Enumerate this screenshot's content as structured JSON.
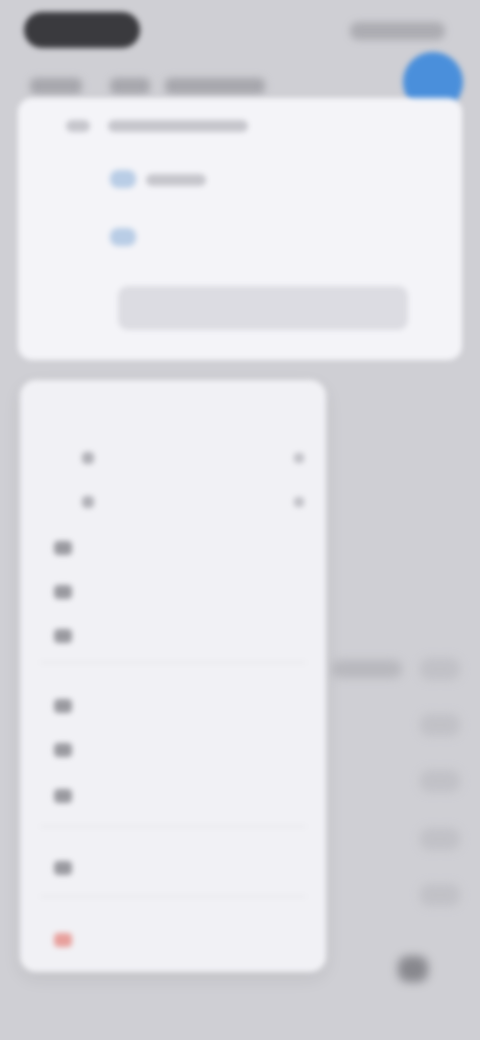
{
  "status_bar": {
    "time": "",
    "indicators": ""
  },
  "background_app": {
    "title": "",
    "fab_icon": "plus-icon",
    "accent_color": "#4a8fdb"
  },
  "menu": {
    "items": [
      {
        "label": "",
        "icon": "list-icon",
        "indent": false
      },
      {
        "label": "",
        "icon": "subitem-icon",
        "indent": true
      },
      {
        "label": "",
        "icon": "subitem-icon",
        "indent": true
      },
      {
        "label": "",
        "icon": "folder-icon",
        "indent": false
      },
      {
        "label": "",
        "icon": "tag-icon",
        "indent": false
      },
      {
        "label": "",
        "icon": "star-icon",
        "indent": false
      },
      {
        "label": "",
        "icon": "share-icon",
        "indent": false
      },
      {
        "label": "",
        "icon": "copy-icon",
        "indent": false
      },
      {
        "label": "",
        "icon": "move-icon",
        "indent": false
      },
      {
        "label": "",
        "icon": "info-icon",
        "indent": false
      },
      {
        "label": "",
        "icon": "trash-icon",
        "indent": false,
        "destructive": true
      }
    ],
    "destructive_color": "#e0605a"
  }
}
